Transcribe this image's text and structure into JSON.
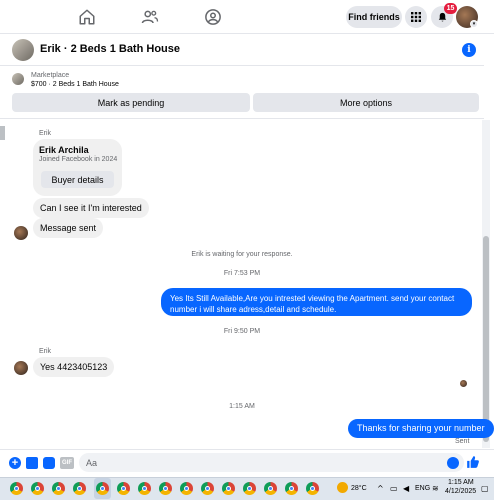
{
  "topnav": {
    "find_friends": "Find friends",
    "notification_count": "15"
  },
  "chat_header": {
    "title": "Erik · 2 Beds 1 Bath House"
  },
  "marketplace": {
    "label": "Marketplace",
    "item": "$700 · 2 Beds 1 Bath House",
    "mark_pending": "Mark as pending",
    "more_options": "More options"
  },
  "messages": {
    "sender_name_1": "Erik",
    "card_name": "Erik Archila",
    "card_joined": "Joined Facebook in 2024",
    "card_button": "Buyer details",
    "msg_1": "Can I see it I'm interested",
    "msg_2": "Message sent",
    "waiting": "Erik is waiting for your response.",
    "time_1": "Fri 7:53 PM",
    "out_1": "Yes Its Still Available,Are you intrested viewing the Apartment. send your contact number i will share adress,detail and schedule.",
    "time_2": "Fri 9:50 PM",
    "sender_name_2": "Erik",
    "msg_3": "Yes 4423405123",
    "time_3": "1:15 AM",
    "out_2": "Thanks for sharing your number",
    "status": "Sent"
  },
  "composer": {
    "placeholder": "Aa",
    "gif_label": "GIF"
  },
  "taskbar": {
    "temperature": "28°C",
    "language": "ENG",
    "time": "1:15 AM",
    "date": "4/12/2025"
  },
  "colors": {
    "accent": "#0866ff",
    "bubble_in": "#f0f0f0",
    "badge": "#e41e3f"
  }
}
